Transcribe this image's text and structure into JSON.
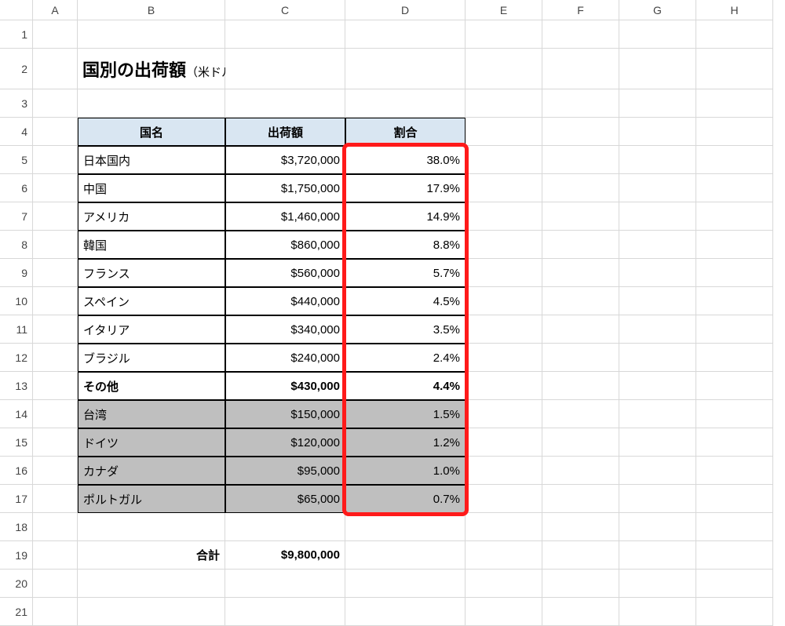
{
  "columns": [
    "A",
    "B",
    "C",
    "D",
    "E",
    "F",
    "G",
    "H"
  ],
  "rows": [
    "1",
    "2",
    "3",
    "4",
    "5",
    "6",
    "7",
    "8",
    "9",
    "10",
    "11",
    "12",
    "13",
    "14",
    "15",
    "16",
    "17",
    "18",
    "19",
    "20",
    "21"
  ],
  "title_main": "国別の出荷額",
  "title_sub": "（米ドル換算）",
  "headers": {
    "country": "国名",
    "amount": "出荷額",
    "ratio": "割合"
  },
  "data_rows": [
    {
      "country": "日本国内",
      "amount": "$3,720,000",
      "ratio": "38.0%",
      "bold": false,
      "shaded": false
    },
    {
      "country": "中国",
      "amount": "$1,750,000",
      "ratio": "17.9%",
      "bold": false,
      "shaded": false
    },
    {
      "country": "アメリカ",
      "amount": "$1,460,000",
      "ratio": "14.9%",
      "bold": false,
      "shaded": false
    },
    {
      "country": "韓国",
      "amount": "$860,000",
      "ratio": "8.8%",
      "bold": false,
      "shaded": false
    },
    {
      "country": "フランス",
      "amount": "$560,000",
      "ratio": "5.7%",
      "bold": false,
      "shaded": false
    },
    {
      "country": "スペイン",
      "amount": "$440,000",
      "ratio": "4.5%",
      "bold": false,
      "shaded": false
    },
    {
      "country": "イタリア",
      "amount": "$340,000",
      "ratio": "3.5%",
      "bold": false,
      "shaded": false
    },
    {
      "country": "ブラジル",
      "amount": "$240,000",
      "ratio": "2.4%",
      "bold": false,
      "shaded": false
    },
    {
      "country": "その他",
      "amount": "$430,000",
      "ratio": "4.4%",
      "bold": true,
      "shaded": false
    },
    {
      "country": "台湾",
      "amount": "$150,000",
      "ratio": "1.5%",
      "bold": false,
      "shaded": true
    },
    {
      "country": "ドイツ",
      "amount": "$120,000",
      "ratio": "1.2%",
      "bold": false,
      "shaded": true
    },
    {
      "country": "カナダ",
      "amount": "$95,000",
      "ratio": "1.0%",
      "bold": false,
      "shaded": true
    },
    {
      "country": "ポルトガル",
      "amount": "$65,000",
      "ratio": "0.7%",
      "bold": false,
      "shaded": true
    }
  ],
  "total": {
    "label": "合計",
    "value": "$9,800,000"
  }
}
